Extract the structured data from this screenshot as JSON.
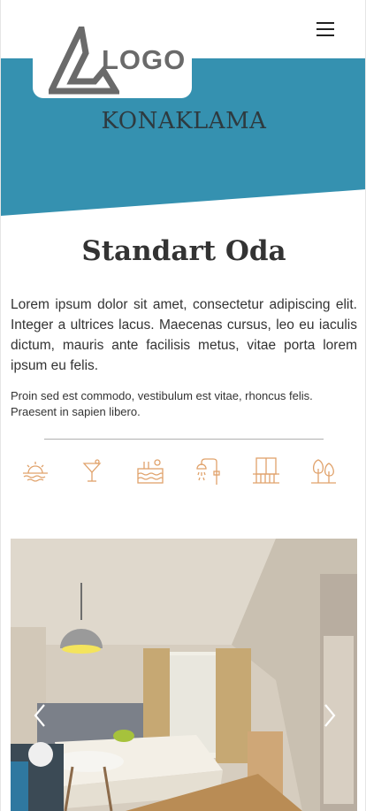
{
  "header": {
    "logo_text": "LOGO",
    "menu_icon": "hamburger-menu-icon"
  },
  "hero": {
    "title": "KONAKLAMA",
    "background_color": "#3591b0"
  },
  "room": {
    "title": "Standart Oda",
    "description_primary": "Lorem ipsum dolor sit amet, consectetur adipiscing elit. Integer a ultrices lacus. Maecenas cursus, leo eu iaculis dictum, mauris ante facilisis metus, vitae porta lorem ipsum eu felis.",
    "description_secondary": "Proin sed est commodo, vestibulum est vitae, rhoncus felis. Praesent in sapien libero."
  },
  "amenities": {
    "icon_color": "#e0a26b",
    "items": [
      {
        "icon": "sunset-sea-view-icon"
      },
      {
        "icon": "cocktail-glass-icon"
      },
      {
        "icon": "pool-icon"
      },
      {
        "icon": "shower-icon"
      },
      {
        "icon": "balcony-icon"
      },
      {
        "icon": "garden-trees-icon"
      }
    ]
  },
  "gallery": {
    "image": "hotel-room-photo",
    "prev_icon": "chevron-left-icon",
    "next_icon": "chevron-right-icon"
  }
}
